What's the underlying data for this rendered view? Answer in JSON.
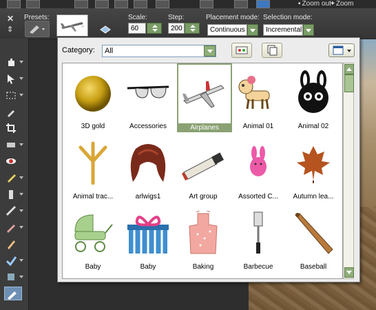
{
  "topbar": {
    "zoom_out_label": "Zoom out",
    "zoom_in_label": "Zoom"
  },
  "options": {
    "presets_label": "Presets:",
    "scale_label": "Scale:",
    "scale_value": "60",
    "step_label": "Step:",
    "step_value": "200",
    "placement_label": "Placement mode:",
    "placement_value": "Continuous",
    "selection_label": "Selection mode:",
    "selection_value": "Incremental"
  },
  "picker": {
    "category_label": "Category:",
    "category_value": "All",
    "items": [
      {
        "label": "3D gold",
        "icon": "gold-sphere-icon"
      },
      {
        "label": "Accessories",
        "icon": "glasses-icon"
      },
      {
        "label": "Airplanes",
        "icon": "airplane-icon",
        "selected": true
      },
      {
        "label": "Animal 01",
        "icon": "dog-icon"
      },
      {
        "label": "Animal 02",
        "icon": "bunny-face-icon"
      },
      {
        "label": "Animal trac...",
        "icon": "bird-track-icon"
      },
      {
        "label": "arlwigs1",
        "icon": "wig-icon"
      },
      {
        "label": "Art group",
        "icon": "paint-tube-icon"
      },
      {
        "label": "Assorted C...",
        "icon": "bunny-candy-icon"
      },
      {
        "label": "Autumn lea...",
        "icon": "leaf-icon"
      },
      {
        "label": "Baby",
        "icon": "stroller-icon"
      },
      {
        "label": "Baby",
        "icon": "gift-icon"
      },
      {
        "label": "Baking",
        "icon": "apron-icon"
      },
      {
        "label": "Barbecue",
        "icon": "spatula-icon"
      },
      {
        "label": "Baseball",
        "icon": "bat-icon"
      }
    ]
  },
  "colors": {
    "accent_green": "#8aa173",
    "selection_blue": "#6d8fb3"
  }
}
